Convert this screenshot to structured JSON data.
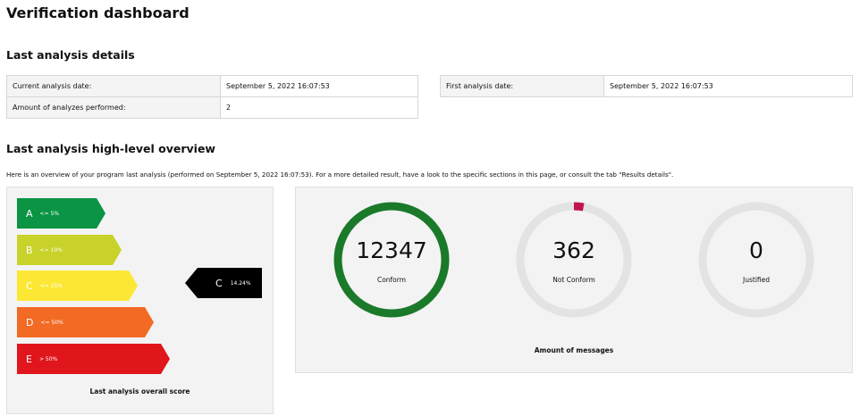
{
  "page": {
    "title": "Verification dashboard"
  },
  "last_analysis_details": {
    "title": "Last analysis details",
    "left_table": [
      {
        "label": "Current analysis date:",
        "value": "September 5, 2022 16:07:53"
      },
      {
        "label": "Amount of analyzes performed:",
        "value": "2"
      }
    ],
    "right_table": [
      {
        "label": "First analysis date:",
        "value": "September 5, 2022 16:07:53"
      }
    ]
  },
  "overview": {
    "title": "Last analysis high-level overview",
    "text": "Here is an overview of your program last analysis (performed on September 5, 2022 16:07:53). For a more detailed result, have a look to the specific sections in this page, or consult the tab \"Results details\"."
  },
  "score": {
    "grades": [
      {
        "letter": "A",
        "threshold": "<= 5%",
        "color": "#0a9444"
      },
      {
        "letter": "B",
        "threshold": "<= 10%",
        "color": "#c9d22a"
      },
      {
        "letter": "C",
        "threshold": "<= 15%",
        "color": "#fce834"
      },
      {
        "letter": "D",
        "threshold": "<= 50%",
        "color": "#f26a24"
      },
      {
        "letter": "E",
        "threshold": "> 50%",
        "color": "#e0161c"
      }
    ],
    "current_grade": "C",
    "current_value": "14.24%",
    "pointer_color": "#000000",
    "caption": "Last analysis overall score"
  },
  "messages": {
    "caption": "Amount of messages",
    "items": [
      {
        "count": "12347",
        "label": "Conform",
        "fraction": 1.0,
        "color": "#1a7a2a"
      },
      {
        "count": "362",
        "label": "Not Conform",
        "fraction": 0.0285,
        "color": "#c0144e"
      },
      {
        "count": "0",
        "label": "Justified",
        "fraction": 0.0,
        "color": "#888888"
      }
    ],
    "track_color": "#e3e3e3"
  }
}
